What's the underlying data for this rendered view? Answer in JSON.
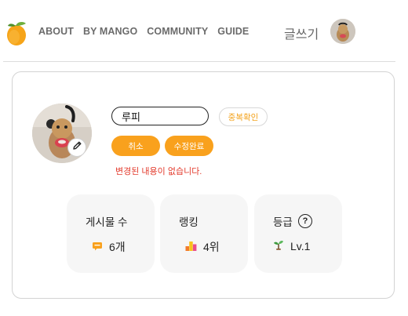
{
  "nav": {
    "items": [
      "ABOUT",
      "BY MANGO",
      "COMMUNITY",
      "GUIDE"
    ],
    "write_label": "글쓰기"
  },
  "profile": {
    "nickname_value": "루피",
    "duplicate_check_label": "중복확인",
    "cancel_label": "취소",
    "save_label": "수정완료",
    "message": "변경된 내용이 없습니다."
  },
  "stats": [
    {
      "label": "게시물 수",
      "icon": "message-icon",
      "value": "6개"
    },
    {
      "label": "랭킹",
      "icon": "ranking-bars-icon",
      "value": "4위"
    },
    {
      "label": "등급",
      "icon": "sprout-icon",
      "value": "Lv.1",
      "help_icon": "question-icon",
      "help_text": "?"
    }
  ],
  "colors": {
    "accent": "#F9A11D",
    "error": "#E33A2C",
    "nav_text": "#6B6B6B"
  }
}
